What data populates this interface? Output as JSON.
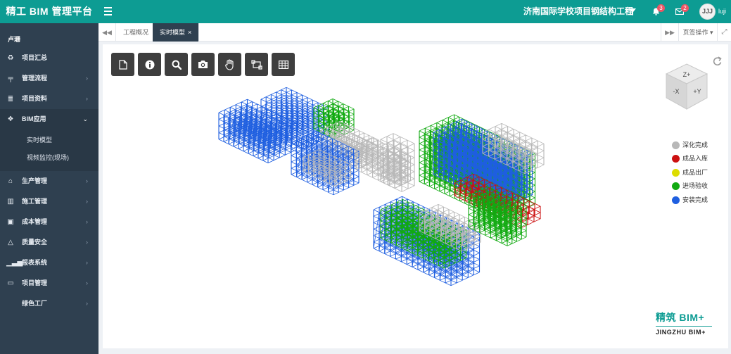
{
  "app": {
    "title": "精工 BIM 管理平台"
  },
  "header": {
    "project_title": "济南国际学校项目钢结构工程",
    "notifications_count": "3",
    "messages_count": "2",
    "avatar_text": "JJJ",
    "username": "luji"
  },
  "sidebar": {
    "user_label": "卢珊",
    "items": [
      {
        "label": "项目汇总",
        "icon": "recycle-icon",
        "has_arrow": false
      },
      {
        "label": "管理流程",
        "icon": "flow-icon",
        "has_arrow": true
      },
      {
        "label": "项目资料",
        "icon": "database-icon",
        "has_arrow": true
      },
      {
        "label": "BIM应用",
        "icon": "cubes-icon",
        "has_arrow": true,
        "expanded": true,
        "children": [
          {
            "label": "实时模型"
          },
          {
            "label": "视频监控(现场)"
          }
        ]
      },
      {
        "label": "生产管理",
        "icon": "factory-icon",
        "has_arrow": true
      },
      {
        "label": "施工管理",
        "icon": "building-icon",
        "has_arrow": true
      },
      {
        "label": "成本管理",
        "icon": "money-icon",
        "has_arrow": true
      },
      {
        "label": "质量安全",
        "icon": "bell-icon",
        "has_arrow": true
      },
      {
        "label": "报表系统",
        "icon": "signal-icon",
        "has_arrow": true
      },
      {
        "label": "项目管理",
        "icon": "desktop-icon",
        "has_arrow": true
      },
      {
        "label": "绿色工厂",
        "icon": "none",
        "has_arrow": true
      }
    ]
  },
  "tabs": {
    "items": [
      {
        "label": "工程概况",
        "active": false
      },
      {
        "label": "实时模型",
        "active": true,
        "close": "×"
      }
    ],
    "page_ops_label": "页签操作",
    "page_ops_caret": "▾"
  },
  "toolbar": {
    "tools": [
      {
        "icon": "file-icon"
      },
      {
        "icon": "info-icon"
      },
      {
        "icon": "search-icon"
      },
      {
        "icon": "camera-icon"
      },
      {
        "icon": "hand-icon"
      },
      {
        "icon": "fit-view-icon"
      },
      {
        "icon": "table-icon"
      }
    ]
  },
  "viewcube": {
    "faces": [
      "Z+",
      "-X",
      "+Y"
    ]
  },
  "legend": {
    "items": [
      {
        "label": "深化完成",
        "color": "#b8b8b8"
      },
      {
        "label": "成品入库",
        "color": "#cc1111"
      },
      {
        "label": "成品出厂",
        "color": "#dddd00"
      },
      {
        "label": "进场验收",
        "color": "#11aa11"
      },
      {
        "label": "安装完成",
        "color": "#1f5fe0"
      }
    ]
  },
  "logo": {
    "cn": "精筑 BIM+",
    "en": "JINGZHU BIM+"
  },
  "colors": {
    "brand": "#0d9c93",
    "sidebar": "#2f4050",
    "active_tab": "#2f4050",
    "badge": "#ed5565"
  }
}
